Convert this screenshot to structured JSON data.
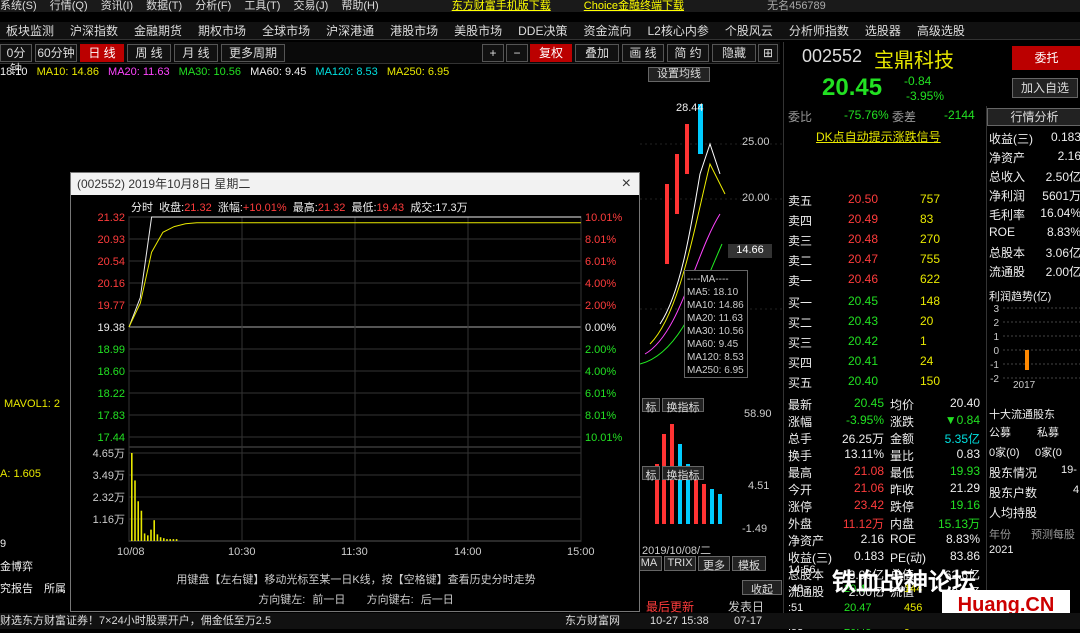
{
  "menu": [
    "系统(S)",
    "行情(Q)",
    "资讯(I)",
    "数据(T)",
    "分析(F)",
    "工具(T)",
    "交易(J)",
    "帮助(H)",
    "东方财富手机版下载",
    "Choice金融终端下载",
    "无名456789"
  ],
  "nav": [
    "板块监测",
    "沪深指数",
    "金融期货",
    "期权市场",
    "全球市场",
    "沪深港通",
    "港股市场",
    "美股市场",
    "DDE决策",
    "资金流向",
    "L2核心内参",
    "个股风云",
    "分析师指数",
    "选股器",
    "高级选股"
  ],
  "toolbar": {
    "p1": "0分钟",
    "p2": "60分钟",
    "day": "日 线",
    "week": "周 线",
    "month": "月 线",
    "more": "更多周期",
    "plus": "+",
    "minus": "−",
    "fq": "复权",
    "overlay": "叠加",
    "draw": "画 线",
    "simple": "简 约",
    "hide": "隐藏",
    "settings": "设置均线"
  },
  "ma": {
    "ma5": "18.10",
    "ma10": "MA10: 14.86",
    "ma20": "MA20: 11.63",
    "ma30": "MA30: 10.56",
    "ma60": "MA60: 9.45",
    "ma120": "MA120: 8.53",
    "ma250": "MA250: 6.95"
  },
  "chart_side": {
    "peak": "28.44",
    "p25": "25.00",
    "p20": "20.00",
    "tag": "14.66",
    "v5890": "58.90",
    "v451": "4.51",
    "vm149": "-1.49",
    "date": "2019/10/08/二"
  },
  "ma_legend": [
    "----MA----",
    "MA5: 18.10",
    "MA10: 14.86",
    "MA20: 11.63",
    "MA30: 10.56",
    "MA60: 9.45",
    "MA120: 8.53",
    "MA250: 6.95"
  ],
  "left": {
    "mavol": "MAVOL1: 2",
    "a1605": "A: 1.605",
    "b9": "9",
    "jin": "金博弈",
    "report": "究报告",
    "suo": "所属"
  },
  "tabs": {
    "biao1": "标",
    "hzb1": "换指标",
    "biao2": "标",
    "hzb2": "换指标",
    "ma": "MA",
    "trix": "TRIX",
    "more": "更多",
    "tmpl": "模板",
    "collapse": "收起",
    "latest": "最后更新",
    "pub": "发表日"
  },
  "stock": {
    "code": "002552",
    "name": "宝鼎科技",
    "price": "20.45",
    "chg": "-0.84",
    "pct": "-3.95%",
    "btn_entrust": "委托",
    "btn_add": "加入自选"
  },
  "wb": {
    "label1": "委比",
    "v1": "-75.76%",
    "label2": "委差",
    "v2": "-2144",
    "signal": "DK点自动提示涨跌信号"
  },
  "asks": [
    {
      "l": "卖五",
      "p": "20.50",
      "v": "757"
    },
    {
      "l": "卖四",
      "p": "20.49",
      "v": "83"
    },
    {
      "l": "卖三",
      "p": "20.48",
      "v": "270"
    },
    {
      "l": "卖二",
      "p": "20.47",
      "v": "755"
    },
    {
      "l": "卖一",
      "p": "20.46",
      "v": "622"
    }
  ],
  "bids": [
    {
      "l": "买一",
      "p": "20.45",
      "v": "148"
    },
    {
      "l": "买二",
      "p": "20.43",
      "v": "20"
    },
    {
      "l": "买三",
      "p": "20.42",
      "v": "1"
    },
    {
      "l": "买四",
      "p": "20.41",
      "v": "24"
    },
    {
      "l": "买五",
      "p": "20.40",
      "v": "150"
    }
  ],
  "stats": [
    {
      "a": "最新",
      "av": "20.45",
      "b": "均价",
      "bv": "20.40"
    },
    {
      "a": "涨幅",
      "av": "-3.95%",
      "b": "涨跌",
      "bv": "▼0.84"
    },
    {
      "a": "总手",
      "av": "26.25万",
      "b": "金额",
      "bv": "5.35亿"
    },
    {
      "a": "换手",
      "av": "13.11%",
      "b": "量比",
      "bv": "0.83"
    },
    {
      "a": "最高",
      "av": "21.08",
      "b": "最低",
      "bv": "19.93"
    },
    {
      "a": "今开",
      "av": "21.06",
      "b": "昨收",
      "bv": "21.29"
    },
    {
      "a": "涨停",
      "av": "23.42",
      "b": "跌停",
      "bv": "19.16"
    },
    {
      "a": "外盘",
      "av": "11.12万",
      "b": "内盘",
      "bv": "15.13万"
    },
    {
      "a": "净资产",
      "av": "2.16",
      "b": "ROE",
      "bv": "8.83%"
    },
    {
      "a": "收益(三)",
      "av": "0.183",
      "b": "PE(动)",
      "bv": "83.86"
    },
    {
      "a": "总股本",
      "av": "3.06亿",
      "b": "总值",
      "bv": "62.6亿"
    },
    {
      "a": "流通股",
      "av": "2.00亿",
      "b": "流值",
      "bv": "40.9亿"
    }
  ],
  "analysis": {
    "title": "行情分析",
    "items": [
      {
        "k": "收益(三)",
        "v": "0.183"
      },
      {
        "k": "净资产",
        "v": "2.16"
      },
      {
        "k": "总收入",
        "v": "2.50亿"
      },
      {
        "k": "净利润",
        "v": "5601万"
      },
      {
        "k": "毛利率",
        "v": "16.04%"
      },
      {
        "k": "ROE",
        "v": "8.83%"
      },
      {
        "k": "总股本",
        "v": "3.06亿"
      },
      {
        "k": "流通股",
        "v": "2.00亿"
      }
    ],
    "trend": "利润趋势(亿)",
    "y": [
      "3",
      "2",
      "1",
      "0",
      "-1",
      "-2"
    ],
    "years": [
      "2017",
      ""
    ],
    "holders": "十大流通股东",
    "gm": "公募",
    "sm": "私募",
    "home0": "0家(0)",
    "home1": "0家(0",
    "gdqk": "股东情况",
    "gdqkv": "19-",
    "gdhs": "股东户数",
    "gdhsv": "4",
    "rjcg": "人均持股",
    "nf": "年份",
    "tzgy": "预测每股",
    "y2021": "2021"
  },
  "ticks": [
    {
      "t": "14:56",
      "p": "",
      "v": ""
    },
    {
      "t": ":48",
      "p": "20.4",
      "v": "144"
    },
    {
      "t": ":51",
      "p": "20.47",
      "v": "456"
    },
    {
      "t": ":53",
      "p": "20.45",
      "v": "9"
    }
  ],
  "popup": {
    "title": "(002552) 2019年10月8日 星期二",
    "info_fs": "分时",
    "info_close_l": "收盘:",
    "info_close": "21.32",
    "info_chg_l": "涨幅:",
    "info_chg": "+10.01%",
    "info_high_l": "最高:",
    "info_high": "21.32",
    "info_low_l": "最低:",
    "info_low": "19.43",
    "info_vol_l": "成交:",
    "info_vol": "17.3万",
    "hint": "用键盘【左右键】移动光标至某一日K线，按【空格键】查看历史分时走势",
    "prev": "方向键左: 前一日",
    "next": "方向键右: 后一日",
    "close_icon": "×"
  },
  "chart_data": {
    "type": "line",
    "title": "(002552) 2019年10月8日 星期二",
    "x": [
      "10/08",
      "10:30",
      "11:30",
      "14:00",
      "15:00"
    ],
    "price_ticks": [
      "21.32",
      "20.93",
      "20.54",
      "20.16",
      "19.77",
      "19.38",
      "18.99",
      "18.60",
      "18.22",
      "17.83",
      "17.44"
    ],
    "pct_ticks": [
      "10.01%",
      "8.01%",
      "6.01%",
      "4.00%",
      "2.00%",
      "0.00%",
      "2.00%",
      "4.00%",
      "6.01%",
      "8.01%",
      "10.01%"
    ],
    "vol_ticks": [
      "4.65万",
      "3.49万",
      "2.32万",
      "1.16万"
    ],
    "ylim": [
      17.44,
      21.32
    ],
    "series": [
      {
        "values": [
          19.38,
          19.9,
          21.32,
          21.32,
          21.32,
          21.32,
          21.32,
          21.32,
          21.32,
          21.32,
          21.32,
          21.32,
          21.32,
          21.32,
          21.32,
          21.32,
          21.32,
          21.32,
          21.32,
          21.32,
          21.32,
          21.32,
          21.32,
          21.32,
          21.32,
          21.32,
          21.32,
          21.32,
          21.32,
          21.32,
          21.32,
          21.32,
          21.32,
          21.32,
          21.32,
          21.32,
          21.32,
          21.32,
          21.32,
          21.32,
          21.32
        ]
      },
      {
        "values": [
          19.38,
          19.8,
          20.7,
          21.05,
          21.15,
          21.2,
          21.22,
          21.22,
          21.22,
          21.22,
          21.22,
          21.22,
          21.22,
          21.22,
          21.22,
          21.22,
          21.22,
          21.22,
          21.22,
          21.22,
          21.22,
          21.22,
          21.22,
          21.22,
          21.22,
          21.22,
          21.22,
          21.22,
          21.22,
          21.22,
          21.22,
          21.22,
          21.22,
          21.22,
          21.22,
          21.22,
          21.22,
          21.22,
          21.22,
          21.22,
          21.22
        ]
      }
    ],
    "volume": [
      4.65,
      3.2,
      2.1,
      1.6,
      0.4,
      0.3,
      0.6,
      1.1,
      0.35,
      0.2,
      0.15,
      0.1,
      0.1,
      0.1,
      0.1
    ]
  },
  "status": {
    "left": "财选东方财富证券！7×24小时股票开户，佣金低至万2.5",
    "mid": "东方财富网",
    "time": "10-27 15:38",
    "date2": "07-17"
  },
  "watermark": "铁血战神论坛",
  "wm2": "Huang.CN"
}
